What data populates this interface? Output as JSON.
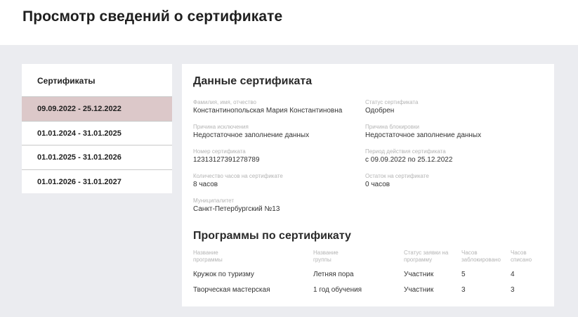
{
  "page": {
    "title": "Просмотр сведений о сертификате"
  },
  "sidebar": {
    "title": "Сертификаты",
    "items": [
      {
        "label": "09.09.2022 - 25.12.2022",
        "active": true
      },
      {
        "label": "01.01.2024 - 31.01.2025",
        "active": false
      },
      {
        "label": "01.01.2025 - 31.01.2026",
        "active": false
      },
      {
        "label": "01.01.2026 - 31.01.2027",
        "active": false
      }
    ]
  },
  "details": {
    "title": "Данные сертификата",
    "full_name": {
      "label": "Фамилия, имя, отчество",
      "value": "Константинопольская Мария Константиновна"
    },
    "status": {
      "label": "Статус сертификата",
      "value": "Одобрен"
    },
    "exclusion_reason": {
      "label": "Причина исключения",
      "value": "Недостаточное заполнение данных"
    },
    "block_reason": {
      "label": "Причина блокировки",
      "value": "Недостаточное заполнение данных"
    },
    "number": {
      "label": "Номер сертификата",
      "value": "12313127391278789"
    },
    "period": {
      "label": "Период действия сертификата",
      "value": "с 09.09.2022 по 25.12.2022"
    },
    "hours": {
      "label": "Количество часов на сертификате",
      "value": "8 часов"
    },
    "remaining": {
      "label": "Остаток на сертификате",
      "value": "0 часов"
    },
    "municipality": {
      "label": "Муниципалитет",
      "value": "Санкт-Петербургский №13"
    }
  },
  "programs": {
    "title": "Программы по сертификату",
    "columns": [
      {
        "line1": "Название",
        "line2": "программы"
      },
      {
        "line1": "Название",
        "line2": "группы"
      },
      {
        "line1": "Статус заявки на",
        "line2": "программу"
      },
      {
        "line1": "Часов",
        "line2": "заблокировано"
      },
      {
        "line1": "Часов",
        "line2": "списано"
      }
    ],
    "rows": [
      {
        "program": "Кружок по туризму",
        "group": "Летняя пора",
        "status": "Участник",
        "blocked": "5",
        "spent": "4"
      },
      {
        "program": "Творческая мастерская",
        "group": "1 год обучения",
        "status": "Участник",
        "blocked": "3",
        "spent": "3"
      }
    ]
  },
  "colors": {
    "background": "#ebecf0",
    "card": "#ffffff",
    "active_item": "#dcc8c9",
    "label": "#b4b4b4",
    "text": "#333333"
  }
}
